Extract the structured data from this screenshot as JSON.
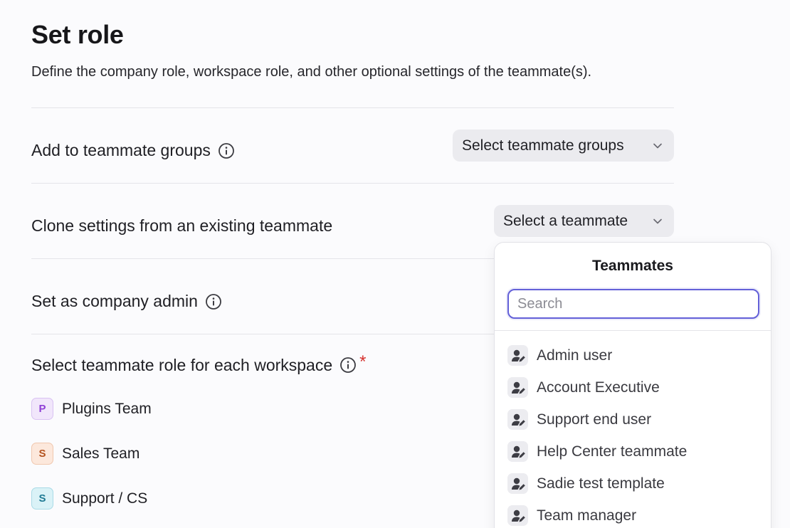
{
  "page": {
    "title": "Set role",
    "subtitle": "Define the company role, workspace role, and other optional settings of the teammate(s)."
  },
  "rows": {
    "groups": {
      "label": "Add to teammate groups",
      "select_label": "Select teammate groups"
    },
    "clone": {
      "label": "Clone settings from an existing teammate",
      "select_label": "Select a teammate"
    },
    "admin": {
      "label": "Set as company admin"
    },
    "workspace_role": {
      "label": "Select teammate role for each workspace",
      "required_mark": "*"
    }
  },
  "workspaces": [
    {
      "initial": "P",
      "name": "Plugins Team",
      "color": "#8f3fd6",
      "bg": "#f1e6fb",
      "border": "#d9c2f2"
    },
    {
      "initial": "S",
      "name": "Sales Team",
      "color": "#b4531f",
      "bg": "#fce8dc",
      "border": "#f0c7ae"
    },
    {
      "initial": "S",
      "name": "Support / CS",
      "color": "#1f7a94",
      "bg": "#daf2f7",
      "border": "#a9dbe7"
    }
  ],
  "dropdown": {
    "title": "Teammates",
    "search_placeholder": "Search",
    "search_value": "",
    "items": [
      {
        "label": "Admin user",
        "icon": "user-icon"
      },
      {
        "label": "Account Executive",
        "icon": "user-icon"
      },
      {
        "label": "Support end user",
        "icon": "user-icon"
      },
      {
        "label": "Help Center teammate",
        "icon": "user-icon"
      },
      {
        "label": "Sadie test template",
        "icon": "user-icon"
      },
      {
        "label": "Team manager",
        "icon": "user-icon"
      }
    ]
  },
  "colors": {
    "accent": "#6360d8",
    "required": "#d6312e",
    "select_bg": "#ebebef",
    "divider": "#e4e4e9"
  }
}
